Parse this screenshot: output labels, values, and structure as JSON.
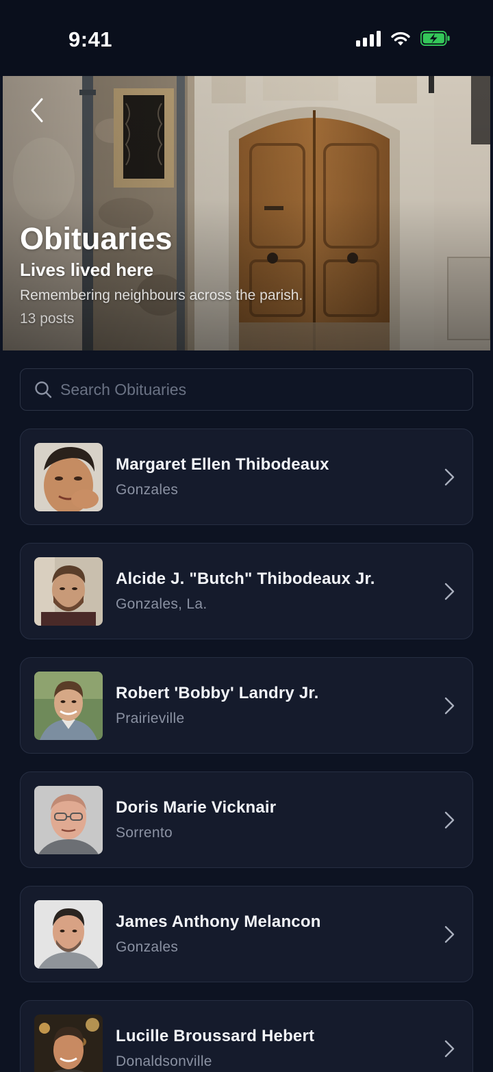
{
  "status_bar": {
    "time": "9:41"
  },
  "hero": {
    "title": "Obituaries",
    "subtitle": "Lives lived here",
    "description": "Remembering neighbours across the parish.",
    "post_count": "13 posts"
  },
  "search": {
    "placeholder": "Search Obituaries",
    "value": ""
  },
  "obituaries": [
    {
      "name": "Margaret Ellen Thibodeaux",
      "location": "Gonzales"
    },
    {
      "name": "Alcide J. \"Butch\" Thibodeaux Jr.",
      "location": "Gonzales, La."
    },
    {
      "name": "Robert 'Bobby' Landry Jr.",
      "location": "Prairieville"
    },
    {
      "name": "Doris Marie Vicknair",
      "location": "Sorrento"
    },
    {
      "name": "James Anthony Melancon",
      "location": "Gonzales"
    },
    {
      "name": "Lucille Broussard Hebert",
      "location": "Donaldsonville"
    }
  ],
  "icons": {
    "back": "chevron-left-icon",
    "search": "search-icon",
    "row": "chevron-right-icon",
    "signal": "cellular-signal-icon",
    "wifi": "wifi-icon",
    "battery": "battery-charging-icon"
  },
  "colors": {
    "background": "#0d1322",
    "card": "#151b2c",
    "card_border": "#262e42",
    "battery_fill": "#34c759"
  }
}
